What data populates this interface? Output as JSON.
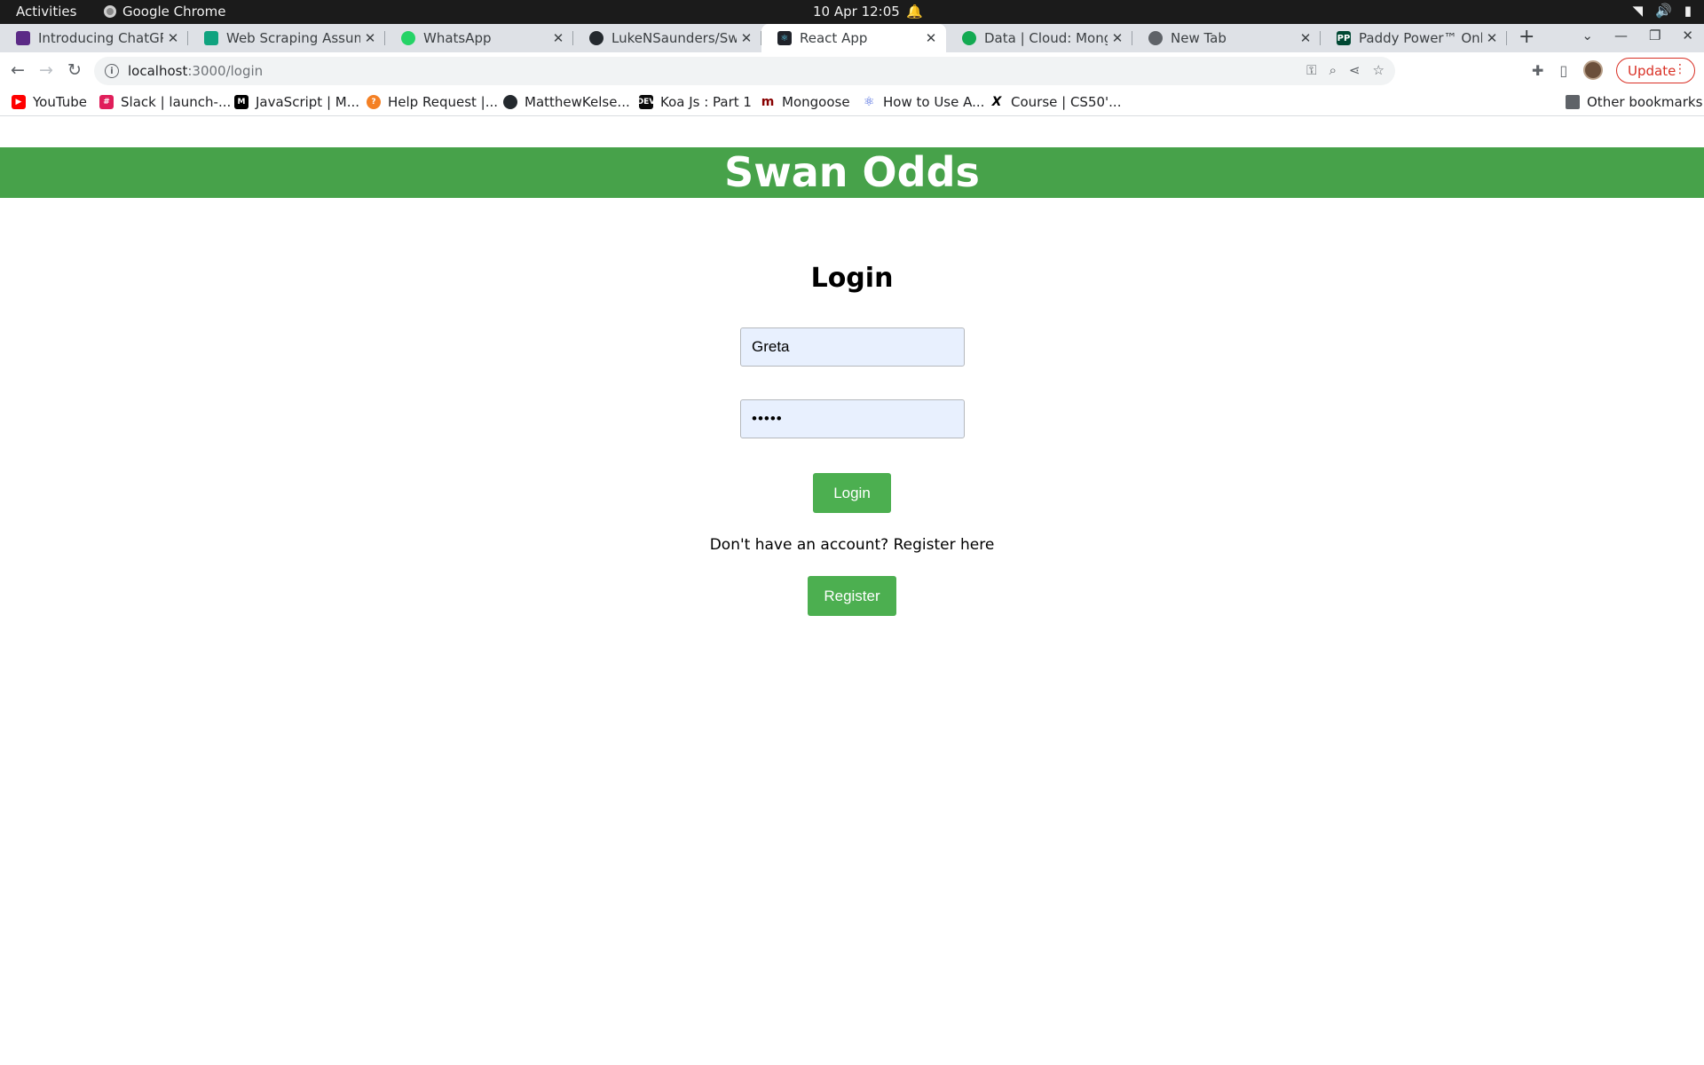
{
  "os": {
    "activities": "Activities",
    "app_name": "Google Chrome",
    "clock": "10 Apr  12:05"
  },
  "tabs": [
    {
      "title": "Introducing ChatGPT",
      "icon": "chatgpt-icon",
      "color": "#5b2a86"
    },
    {
      "title": "Web Scraping Assump",
      "icon": "openai-icon",
      "color": "#10a37f"
    },
    {
      "title": "WhatsApp",
      "icon": "whatsapp-icon",
      "color": "#25d366"
    },
    {
      "title": "LukeNSaunders/Swin",
      "icon": "github-icon",
      "color": "#24292e"
    },
    {
      "title": "React App",
      "icon": "react-icon",
      "color": "#20232a",
      "active": true
    },
    {
      "title": "Data | Cloud: MongoD",
      "icon": "mongodb-icon",
      "color": "#13aa52"
    },
    {
      "title": "New Tab",
      "icon": "chrome-icon",
      "color": "#5f6368"
    },
    {
      "title": "Paddy Power™ Online",
      "icon": "paddypower-icon",
      "color": "#004833"
    }
  ],
  "address_bar": {
    "host": "localhost",
    "path": ":3000/login"
  },
  "update_label": "Update",
  "bookmarks": [
    {
      "label": "YouTube",
      "icon": "youtube-icon",
      "color": "#ff0000"
    },
    {
      "label": "Slack | launch-...",
      "icon": "slack-icon",
      "color": "#e01e5a"
    },
    {
      "label": "JavaScript | M...",
      "icon": "mdn-icon",
      "color": "#000000"
    },
    {
      "label": "Help Request |...",
      "icon": "help-icon",
      "color": "#f48024"
    },
    {
      "label": "MatthewKelse...",
      "icon": "github-icon",
      "color": "#24292e"
    },
    {
      "label": "Koa Js : Part 1",
      "icon": "dev-icon",
      "color": "#0a0a0a"
    },
    {
      "label": "Mongoose",
      "icon": "mongoose-icon",
      "color": "#880000"
    },
    {
      "label": "How to Use A...",
      "icon": "react-icon",
      "color": "#61dafb"
    },
    {
      "label": "Course | CS50'...",
      "icon": "edx-icon",
      "color": "#000000"
    }
  ],
  "other_bookmarks": "Other bookmarks",
  "app": {
    "brand": "Swan Odds",
    "brand_color": "#47a24a",
    "login_heading": "Login",
    "username_value": "Greta",
    "password_value": "•••••",
    "login_button": "Login",
    "register_prompt": "Don't have an account? Register here",
    "register_button": "Register",
    "button_color": "#4caf50"
  }
}
